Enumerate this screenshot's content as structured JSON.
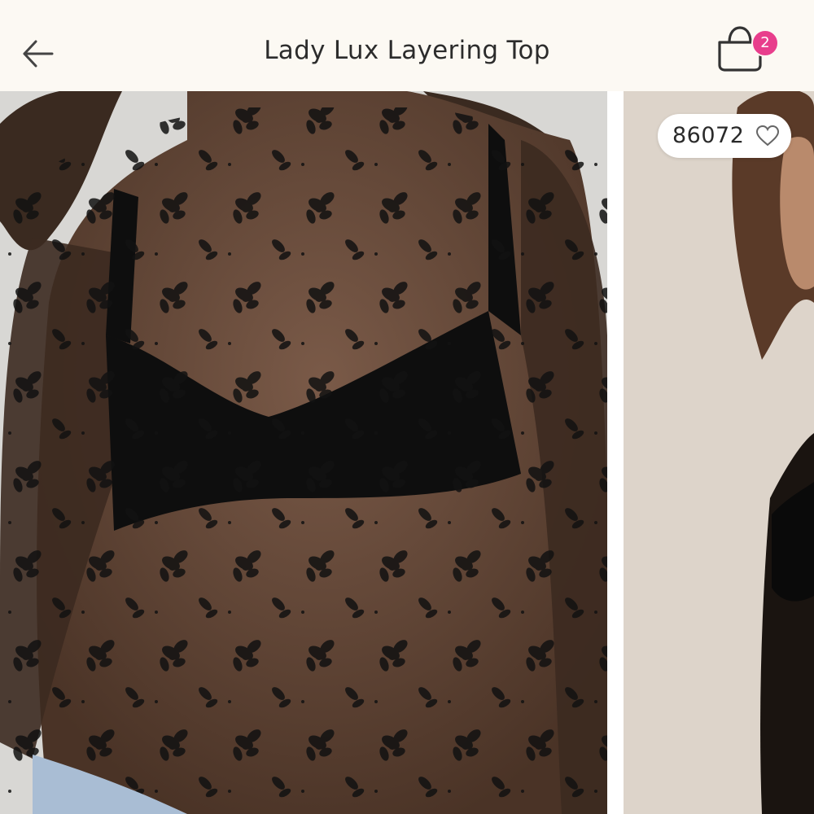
{
  "header": {
    "title": "Lady Lux Layering Top",
    "back_icon": "arrow-left-icon",
    "bag_icon": "shopping-bag-icon",
    "bag_count": "2",
    "badge_color": "#e83e8c",
    "background_color": "#fcf9f3"
  },
  "gallery": {
    "like_count": "86072",
    "like_icon": "heart-outline-icon",
    "images": [
      "product-photo-front-sheer-black-lace-top",
      "product-photo-model-side"
    ]
  }
}
